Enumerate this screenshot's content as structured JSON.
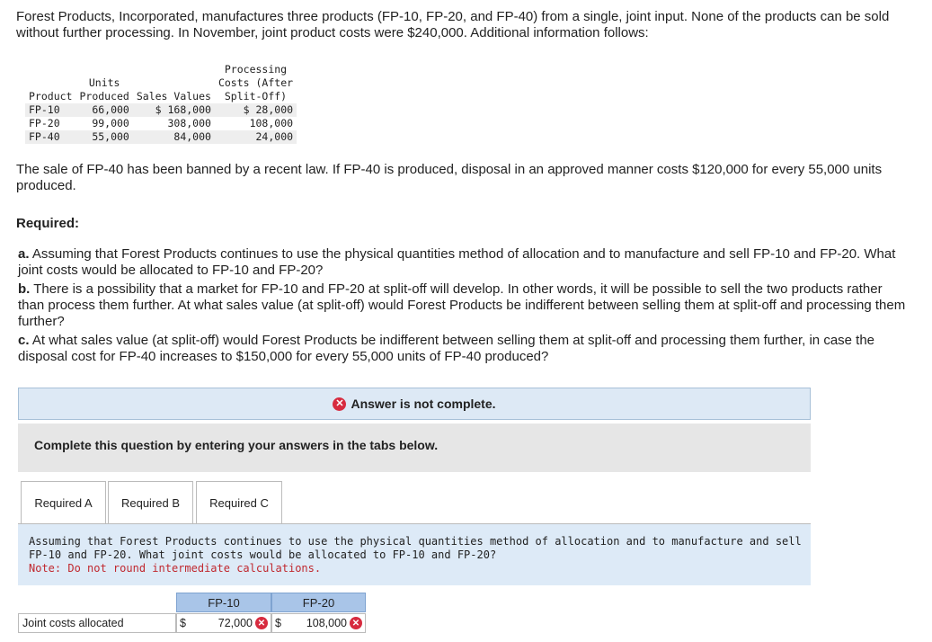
{
  "intro_text": "Forest Products, Incorporated, manufactures three products (FP-10, FP-20, and FP-40) from a single, joint input. None of the products can be sold without further processing. In November, joint product costs were $240,000. Additional information follows:",
  "table": {
    "headers": {
      "product": "Product",
      "units_line1": "Units",
      "units_line2": "Produced",
      "sales": "Sales Values",
      "proc_line1": "Processing",
      "proc_line2": "Costs (After",
      "proc_line3": "Split-Off)"
    },
    "rows": [
      {
        "product": "FP-10",
        "units": "66,000",
        "sales": "$ 168,000",
        "proc": "$ 28,000"
      },
      {
        "product": "FP-20",
        "units": "99,000",
        "sales": "308,000",
        "proc": "108,000"
      },
      {
        "product": "FP-40",
        "units": "55,000",
        "sales": "84,000",
        "proc": "24,000"
      }
    ]
  },
  "law_text": "The sale of FP-40 has been banned by a recent law. If FP-40 is produced, disposal in an approved manner costs $120,000 for every 55,000 units produced.",
  "required_heading": "Required:",
  "questions": [
    {
      "mark": "a.",
      "text": "Assuming that Forest Products continues to use the physical quantities method of allocation and to manufacture and sell FP-10 and FP-20. What joint costs would be allocated to FP-10 and FP-20?"
    },
    {
      "mark": "b.",
      "text": "There is a possibility that a market for FP-10 and FP-20 at split-off will develop. In other words, it will be possible to sell the two products rather than process them further. At what sales value (at split-off) would Forest Products be indifferent between selling them at split-off and processing them further?"
    },
    {
      "mark": "c.",
      "text": "At what sales value (at split-off) would Forest Products be indifferent between selling them at split-off and processing them further, in case the disposal cost for FP-40 increases to $150,000 for every 55,000 units of FP-40 produced?"
    }
  ],
  "banner_text": "Answer is not complete.",
  "instruction": "Complete this question by entering your answers in the tabs below.",
  "tabs": [
    "Required A",
    "Required B",
    "Required C"
  ],
  "panel": {
    "text": "Assuming that Forest Products continues to use the physical quantities method of allocation and to manufacture and sell FP-10 and FP-20. What joint costs would be allocated to FP-10 and FP-20?",
    "note": "Note: Do not round intermediate calculations."
  },
  "answer_table": {
    "col1": "FP-10",
    "col2": "FP-20",
    "row_label": "Joint costs allocated",
    "currency": "$",
    "fp10_value": "72,000",
    "fp20_value": "108,000",
    "status_icon": "x-circle-icon",
    "error_color": "#d72b3f"
  }
}
